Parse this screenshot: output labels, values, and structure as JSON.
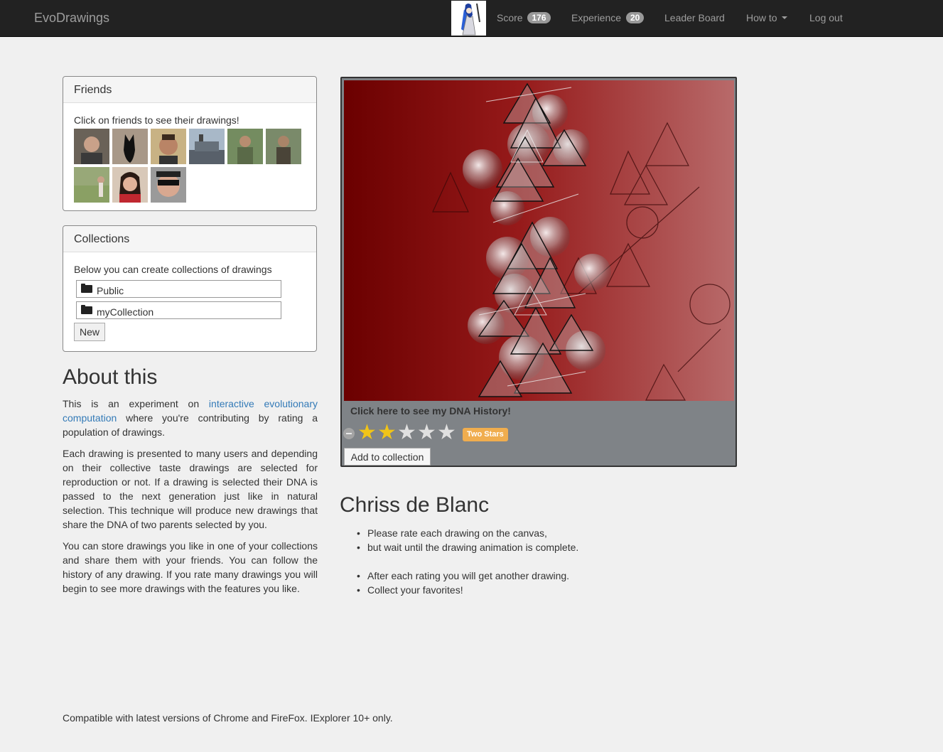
{
  "navbar": {
    "brand": "EvoDrawings",
    "score_label": "Score",
    "score_value": "176",
    "experience_label": "Experience",
    "experience_value": "20",
    "leaderboard": "Leader Board",
    "howto": "How to",
    "logout": "Log out"
  },
  "friends": {
    "title": "Friends",
    "hint": "Click on friends to see their drawings!",
    "count": 9
  },
  "collections": {
    "title": "Collections",
    "hint": "Below you can create collections of drawings",
    "items": [
      {
        "label": "Public"
      },
      {
        "label": "myCollection"
      }
    ],
    "new_button": "New"
  },
  "about": {
    "title": "About this",
    "p1_start": "This is an experiment on ",
    "p1_link": "interactive evolutionary computation",
    "p1_end": " where you're contributing by rating a population of drawings.",
    "p2": "Each drawing is presented to many users and depending on their collective taste drawings are selected for reproduction or not. If a drawing is selected their DNA is passed to the next generation just like in natural selection. This technique will produce new drawings that share the DNA of two parents selected by you.",
    "p3": "You can store drawings you like in one of your collections and share them with your friends. You can follow the history of any drawing. If you rate many drawings you will begin to see more drawings with the features you like."
  },
  "drawing": {
    "dna_link": "Click here to see my DNA History!",
    "rating_value": 2,
    "rating_max": 5,
    "rating_label": "Two Stars",
    "add_button": "Add to collection",
    "colors": {
      "dark_red": "#6b0000",
      "mid_red": "#a33030",
      "light_red": "#c87070"
    }
  },
  "user": {
    "name": "Chriss de Blanc",
    "instructions": [
      "Please rate each drawing on the canvas,",
      "but wait until the drawing animation is complete.",
      "After each rating you will get another drawing.",
      "Collect your favorites!"
    ]
  },
  "footer": "Compatible with latest versions of Chrome and FireFox. IExplorer 10+ only."
}
